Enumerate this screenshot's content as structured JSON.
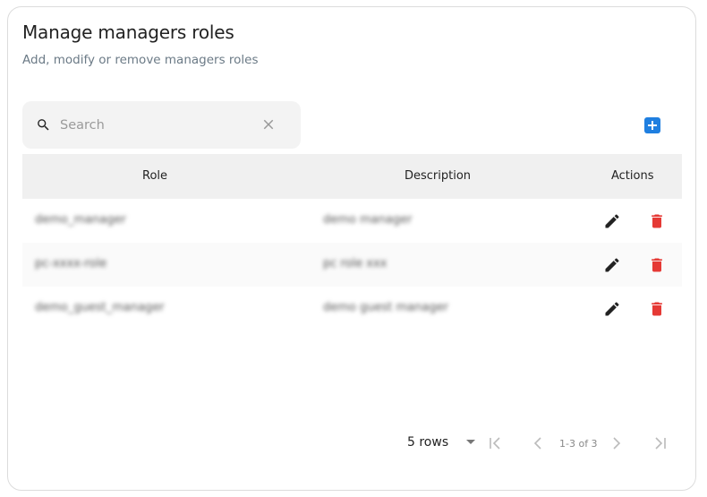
{
  "header": {
    "title": "Manage managers roles",
    "subtitle": "Add, modify or remove managers roles"
  },
  "search": {
    "placeholder": "Search",
    "value": ""
  },
  "table": {
    "columns": [
      "Role",
      "Description",
      "Actions"
    ],
    "rows": [
      {
        "role": "demo_manager",
        "description": "demo manager"
      },
      {
        "role": "pc-xxxx-role",
        "description": "pc role xxx"
      },
      {
        "role": "demo_guest_manager",
        "description": "demo guest manager"
      }
    ]
  },
  "pagination": {
    "rows_label": "5 rows",
    "range": "1-3 of 3"
  },
  "colors": {
    "accent": "#1f7fe0",
    "delete": "#e53935"
  }
}
